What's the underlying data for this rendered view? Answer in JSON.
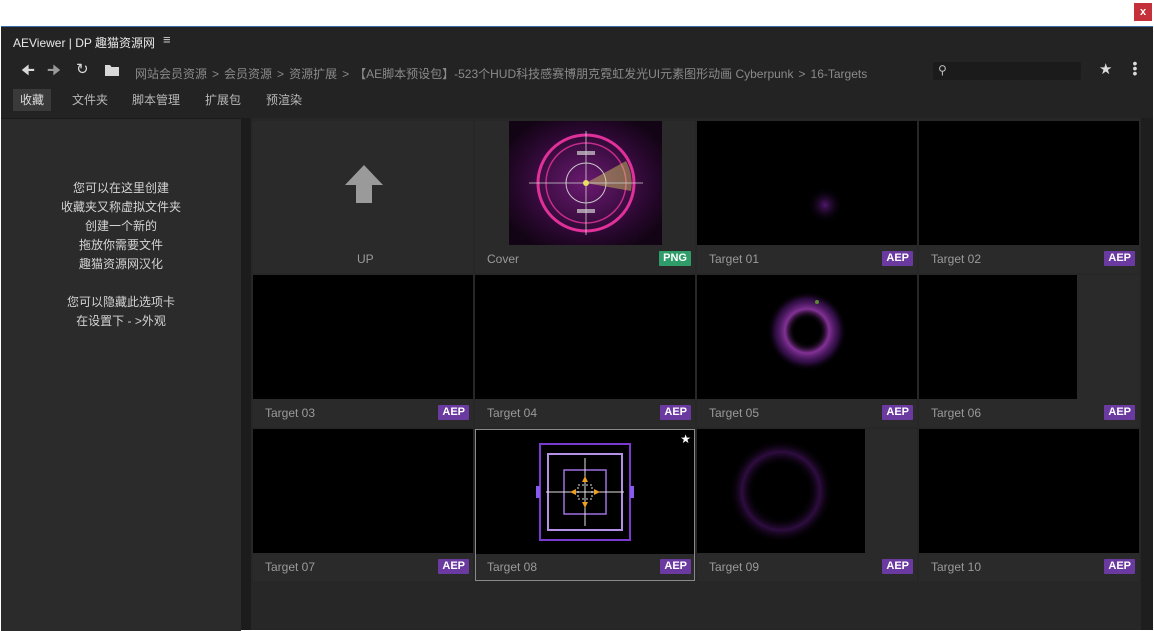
{
  "window": {
    "close_label": "x",
    "title": "AEViewer | DP 趣猫资源网",
    "menu_icon": "hamburger-icon"
  },
  "toolbar": {
    "back_icon": "arrow-left-icon",
    "forward_icon": "arrow-right-icon",
    "refresh_icon": "refresh-icon",
    "folder_icon": "folder-icon",
    "breadcrumbs": [
      "网站会员资源",
      "会员资源",
      "资源扩展",
      "【AE脚本预设包】-523个HUD科技感赛博朋克霓虹发光UI元素图形动画 Cyberpunk",
      "16-Targets"
    ],
    "separator": ">",
    "search_placeholder": "",
    "search_icon": "search-icon",
    "star_icon": "star-icon",
    "more_icon": "more-vertical-icon"
  },
  "tabs": [
    {
      "label": "收藏",
      "active": true
    },
    {
      "label": "文件夹",
      "active": false
    },
    {
      "label": "脚本管理",
      "active": false
    },
    {
      "label": "扩展包",
      "active": false
    },
    {
      "label": "预渲染",
      "active": false
    }
  ],
  "sidebar": {
    "lines": [
      "您可以在这里创建",
      "收藏夹又称虚拟文件夹",
      "创建一个新的",
      "拖放你需要文件",
      "趣猫资源网汉化",
      "",
      "您可以隐藏此选项卡",
      "在设置下 - >外观"
    ]
  },
  "items": [
    {
      "label": "UP",
      "badge": "",
      "type": "up"
    },
    {
      "label": "Cover",
      "badge": "PNG",
      "type": "cover"
    },
    {
      "label": "Target 01",
      "badge": "AEP",
      "type": "dot"
    },
    {
      "label": "Target 02",
      "badge": "AEP",
      "type": "blank"
    },
    {
      "label": "Target 03",
      "badge": "AEP",
      "type": "blank"
    },
    {
      "label": "Target 04",
      "badge": "AEP",
      "type": "blank"
    },
    {
      "label": "Target 05",
      "badge": "AEP",
      "type": "ring"
    },
    {
      "label": "Target 06",
      "badge": "AEP",
      "type": "blank"
    },
    {
      "label": "Target 07",
      "badge": "AEP",
      "type": "blank"
    },
    {
      "label": "Target 08",
      "badge": "AEP",
      "type": "square",
      "favorite": true
    },
    {
      "label": "Target 09",
      "badge": "AEP",
      "type": "faint-ring"
    },
    {
      "label": "Target 10",
      "badge": "AEP",
      "type": "blank"
    }
  ],
  "colors": {
    "accent": "#3a6ea8",
    "aep_badge": "#6a3aa0",
    "png_badge": "#2f9d6a",
    "close": "#c4313b"
  }
}
